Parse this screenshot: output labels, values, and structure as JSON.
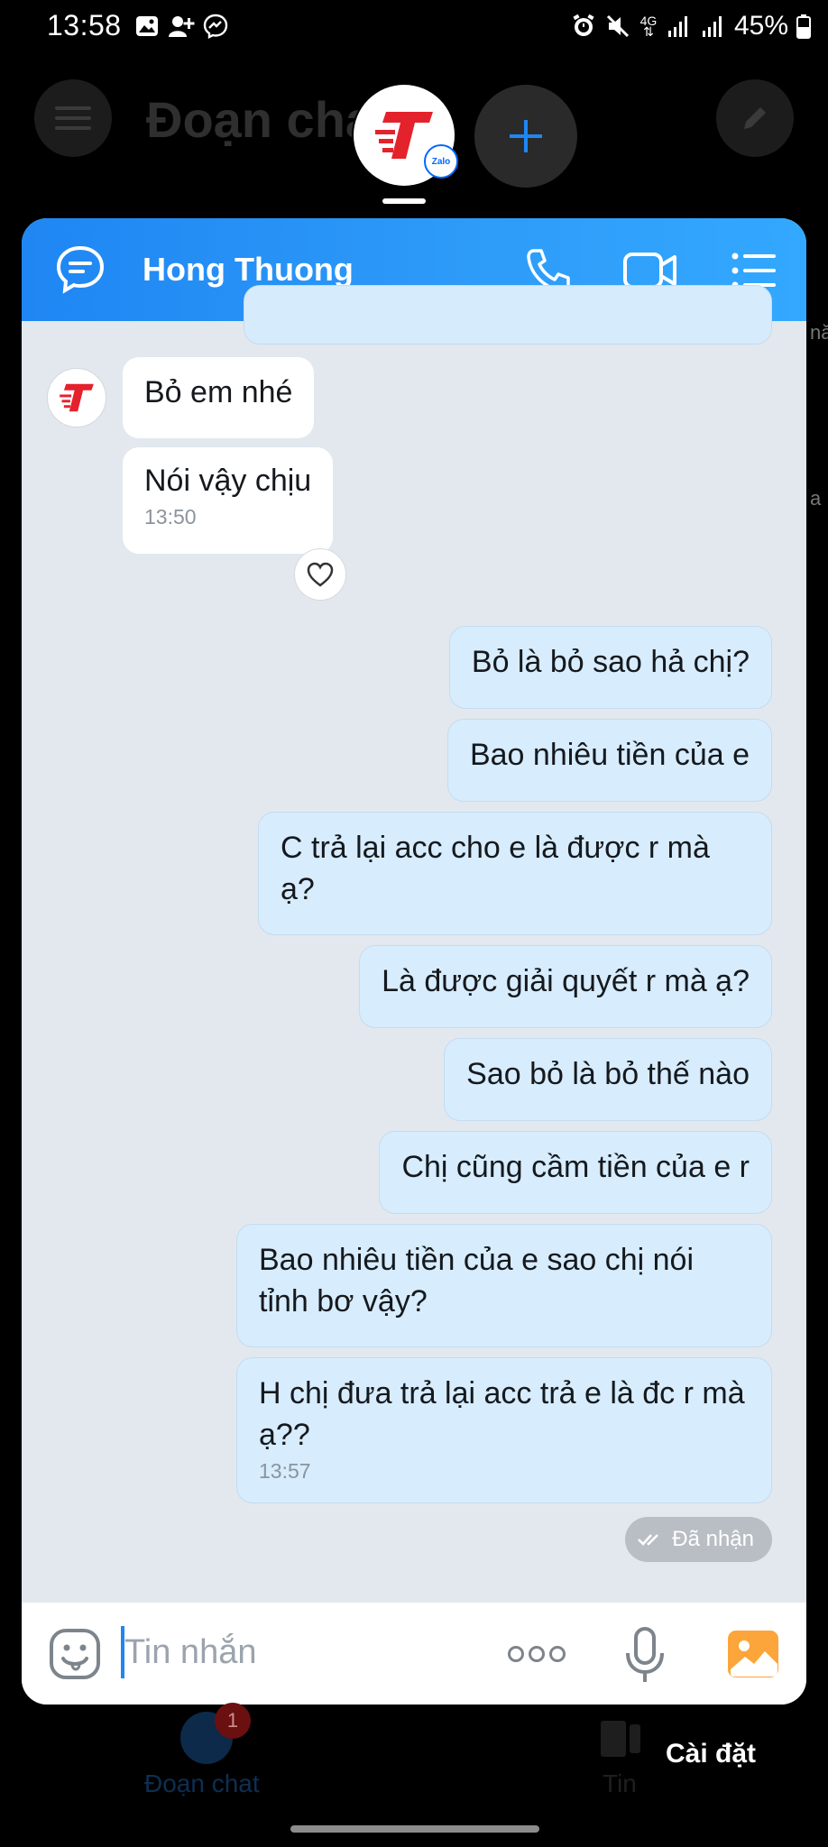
{
  "status_bar": {
    "time": "13:58",
    "network": "4G",
    "battery": "45%"
  },
  "background": {
    "title": "Đoạn chat",
    "nav": {
      "chat_label": "Đoạn chat",
      "chat_badge": "1",
      "stories_label": "Tin"
    },
    "settings_label": "Cài đặt",
    "peek_text_1": "nă",
    "peek_text_2": "a"
  },
  "chat_head": {
    "zalo_badge": "Zalo"
  },
  "chat": {
    "contact_name": "Hong Thuong",
    "previous_time": "13:50",
    "incoming": [
      {
        "text": "Bỏ em nhé"
      },
      {
        "text": "Nói vậy chịu",
        "time": "13:50"
      }
    ],
    "outgoing": [
      {
        "text": "Bỏ là bỏ sao hả chị?"
      },
      {
        "text": "Bao nhiêu tiền của e"
      },
      {
        "text": "C trả lại acc cho e là được r mà ạ?"
      },
      {
        "text": "Là được giải quyết r mà ạ?"
      },
      {
        "text": "Sao bỏ là bỏ thế nào"
      },
      {
        "text": "Chị cũng cầm tiền của e r"
      },
      {
        "text": "Bao nhiêu tiền của e sao chị nói tỉnh bơ vậy?"
      },
      {
        "text": "H chị đưa trả lại acc trả e là đc r mà ạ??",
        "time": "13:57"
      }
    ],
    "delivery_status": "Đã nhận"
  },
  "composer": {
    "placeholder": "Tin nhắn"
  },
  "colors": {
    "header_blue": "#1f86f3",
    "outgoing_bubble": "#d7ecfc",
    "chat_bg": "#e3e8ef",
    "brand_red": "#e4222c"
  },
  "icons": [
    "image-icon",
    "add-person-icon",
    "messenger-icon",
    "alarm-icon",
    "mute-icon",
    "signal-icon",
    "battery-icon",
    "menu-icon",
    "pencil-icon",
    "plus-icon",
    "chat-bubble-icon",
    "phone-icon",
    "video-icon",
    "list-icon",
    "heart-icon",
    "double-check-icon",
    "emoji-icon",
    "more-icon",
    "mic-icon",
    "gallery-icon"
  ]
}
